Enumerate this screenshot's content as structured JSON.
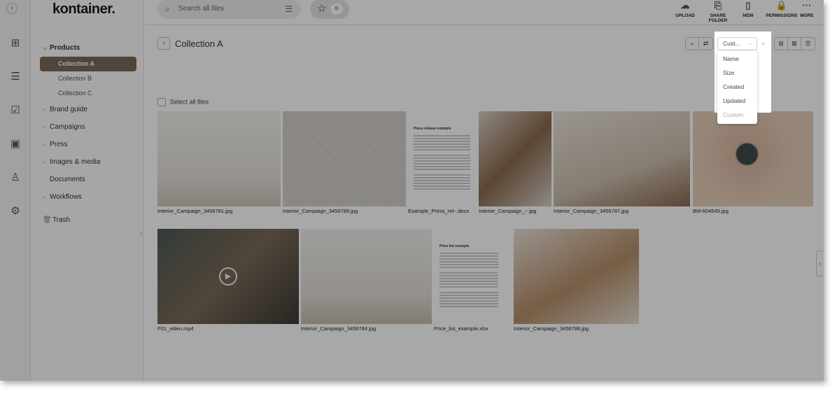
{
  "app": {
    "logo": "kontainer."
  },
  "rail": {
    "items": [
      {
        "icon": "collapse-icon",
        "glyph": "‹"
      },
      {
        "icon": "grid-icon",
        "glyph": "⊞"
      },
      {
        "icon": "list-icon",
        "glyph": "☰"
      },
      {
        "icon": "approval-icon",
        "glyph": "☑"
      },
      {
        "icon": "briefcase-icon",
        "glyph": "▣"
      },
      {
        "icon": "user-icon",
        "glyph": "♙"
      },
      {
        "icon": "settings-icon",
        "glyph": "⚙"
      }
    ]
  },
  "sidebar": {
    "items": [
      {
        "label": "Products",
        "type": "open"
      },
      {
        "label": "Collection A",
        "type": "sub",
        "active": true
      },
      {
        "label": "Collection B",
        "type": "sub"
      },
      {
        "label": "Collection C",
        "type": "sub"
      },
      {
        "label": "Brand guide",
        "type": "closed"
      },
      {
        "label": "Campaigns",
        "type": "closed"
      },
      {
        "label": "Press",
        "type": "closed"
      },
      {
        "label": "Images & media",
        "type": "closed"
      },
      {
        "label": "Documents",
        "type": "leaf"
      },
      {
        "label": "Workflows",
        "type": "closed"
      },
      {
        "label": "Trash",
        "type": "trash"
      }
    ]
  },
  "topbar": {
    "search_placeholder": "Search all files",
    "favorites_count": "0",
    "actions": [
      {
        "label": "UPLOAD",
        "icon": "cloud-upload-icon"
      },
      {
        "label": "SHARE FOLDER",
        "icon": "share-folder-icon"
      },
      {
        "label": "NEW",
        "icon": "new-file-icon"
      },
      {
        "label": "PERMISSIONS",
        "icon": "lock-icon"
      },
      {
        "label": "MORE",
        "icon": "more-icon"
      }
    ]
  },
  "main": {
    "title": "Collection A",
    "select_all": "Select all files",
    "sort": {
      "selected": "Cust...",
      "options": [
        "Name",
        "Size",
        "Created",
        "Updated",
        "Custom"
      ]
    },
    "files": [
      {
        "name": "Interior_Campaign_3456781.jpg"
      },
      {
        "name": "Interior_Campaign_3456789.jpg"
      },
      {
        "name": "Example_Press_rel~.docx",
        "doc_title": "Press release example"
      },
      {
        "name": "Interior_Campaign_~.jpg"
      },
      {
        "name": "Interior_Campaign_3456787.jpg"
      },
      {
        "name": "BM-604549.jpg"
      },
      {
        "name": "F01_video.mp4"
      },
      {
        "name": "Interior_Campaign_3456784.jpg"
      },
      {
        "name": "Price_list_example.xlsx",
        "doc_title": "Price list example"
      },
      {
        "name": "Interior_Campaign_3456788.jpg"
      }
    ]
  }
}
